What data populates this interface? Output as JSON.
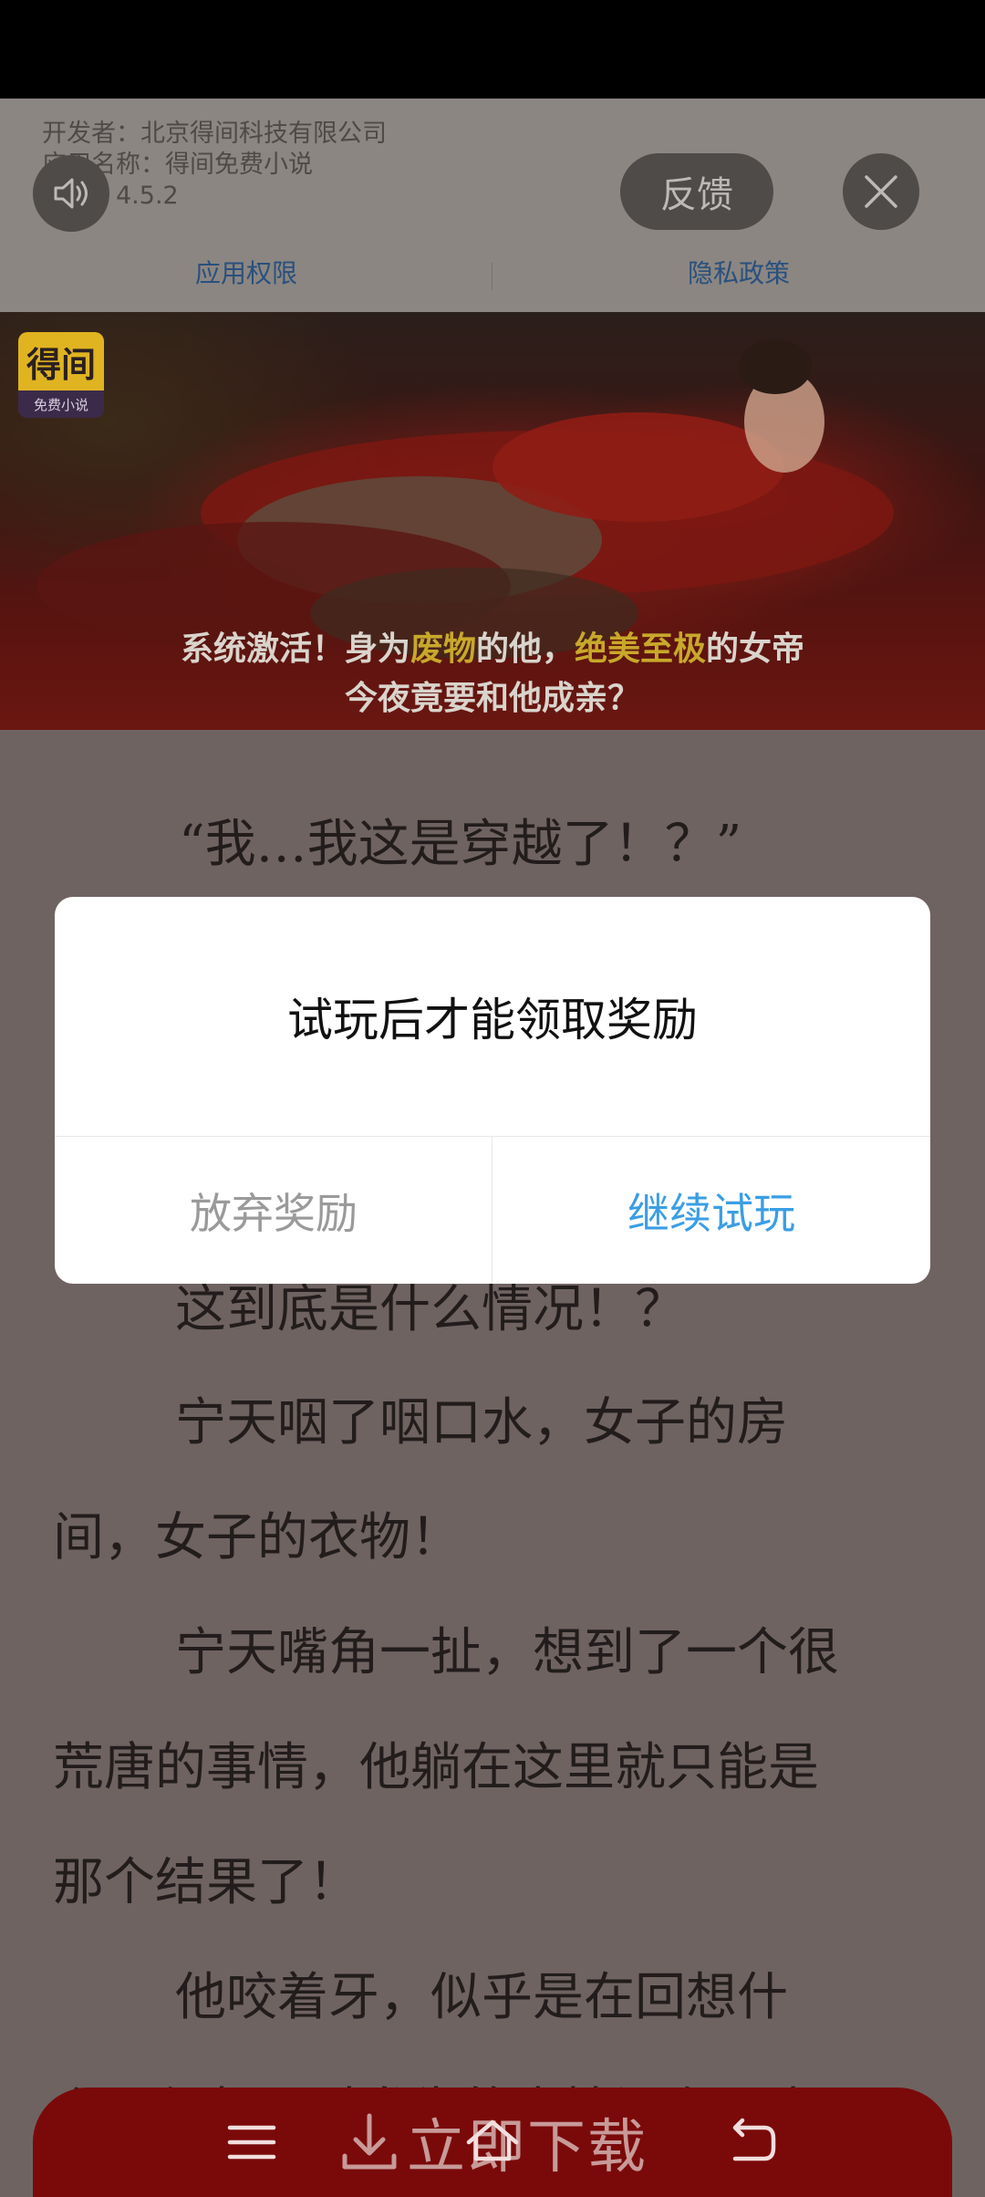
{
  "ad_header": {
    "developer": "开发者：北京得间科技有限公司",
    "app_name": "应用名称：得间免费小说",
    "version": "版本：4.5.2",
    "feedback_label": "反馈",
    "permissions_link": "应用权限",
    "privacy_link": "隐私政策"
  },
  "banner": {
    "logo_text": "得间",
    "logo_subtext": "免费小说",
    "caption_line1_a": "系统激活！身为",
    "caption_line1_b": "废物",
    "caption_line1_c": "的他，",
    "caption_line1_d": "绝美至极",
    "caption_line1_e": "的女帝",
    "caption_line2": "今夜竟要和他成亲？"
  },
  "reader": {
    "lines": [
      "“我…我这是穿越了！？”",
      "这到底是什么情况！？",
      "宁天咽了咽口水，女子的房",
      "间，女子的衣物！",
      "宁天嘴角一扯，想到了一个很",
      "荒唐的事情，他躺在这里就只能是",
      "那个结果了！",
      "他咬着牙，似乎是在回想什",
      "么，但却是对发生的事情没有一点"
    ]
  },
  "dialog": {
    "title": "试玩后才能领取奖励",
    "cancel_label": "放弃奖励",
    "confirm_label": "继续试玩",
    "confirm_color": "#3a9ee4",
    "cancel_color": "#9a9a9a"
  },
  "bottom_bar": {
    "download_label": "立即下载",
    "color": "#7a0a0a"
  }
}
